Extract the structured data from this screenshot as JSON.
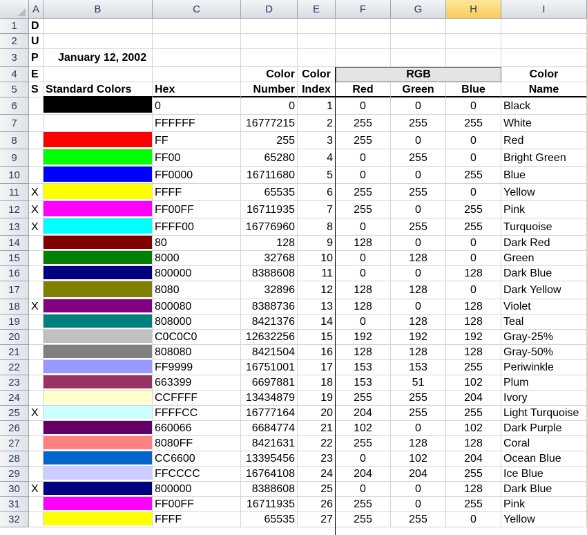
{
  "columns": [
    "A",
    "B",
    "C",
    "D",
    "E",
    "F",
    "G",
    "H",
    "I"
  ],
  "selected_column": "H",
  "row_numbers": [
    "1",
    "2",
    "3",
    "4",
    "5",
    "6",
    "7",
    "8",
    "9",
    "10",
    "11",
    "12",
    "13",
    "14",
    "15",
    "16",
    "17",
    "18",
    "19",
    "20",
    "21",
    "22",
    "23",
    "24",
    "25",
    "26",
    "27",
    "28",
    "29",
    "30",
    "31",
    "32"
  ],
  "col_a_letters": {
    "1": "D",
    "2": "U",
    "3": "P",
    "4": "E",
    "5": "S"
  },
  "date": "January 12, 2002",
  "headers": {
    "standard_colors": "Standard Colors",
    "hex": "Hex",
    "color_number_line1": "Color",
    "color_number_line2": "Number",
    "color_index_line1": "Color",
    "color_index_line2": "Index",
    "rgb": "RGB",
    "red": "Red",
    "green": "Green",
    "blue": "Blue",
    "color_name_line1": "Color",
    "color_name_line2": "Name"
  },
  "data_rows": [
    {
      "dup": "",
      "swatch": "#000000",
      "hex": "0",
      "number": "0",
      "index": "1",
      "red": "0",
      "green": "0",
      "blue": "0",
      "name": "Black"
    },
    {
      "dup": "",
      "swatch": "#FFFFFF",
      "hex": "FFFFFF",
      "number": "16777215",
      "index": "2",
      "red": "255",
      "green": "255",
      "blue": "255",
      "name": "White"
    },
    {
      "dup": "",
      "swatch": "#FF0000",
      "hex": "FF",
      "number": "255",
      "index": "3",
      "red": "255",
      "green": "0",
      "blue": "0",
      "name": "Red"
    },
    {
      "dup": "",
      "swatch": "#00FF00",
      "hex": "FF00",
      "number": "65280",
      "index": "4",
      "red": "0",
      "green": "255",
      "blue": "0",
      "name": "Bright Green"
    },
    {
      "dup": "",
      "swatch": "#0000FF",
      "hex": "FF0000",
      "number": "16711680",
      "index": "5",
      "red": "0",
      "green": "0",
      "blue": "255",
      "name": "Blue"
    },
    {
      "dup": "X",
      "swatch": "#FFFF00",
      "hex": "FFFF",
      "number": "65535",
      "index": "6",
      "red": "255",
      "green": "255",
      "blue": "0",
      "name": "Yellow"
    },
    {
      "dup": "X",
      "swatch": "#FF00FF",
      "hex": "FF00FF",
      "number": "16711935",
      "index": "7",
      "red": "255",
      "green": "0",
      "blue": "255",
      "name": "Pink"
    },
    {
      "dup": "X",
      "swatch": "#00FFFF",
      "hex": "FFFF00",
      "number": "16776960",
      "index": "8",
      "red": "0",
      "green": "255",
      "blue": "255",
      "name": "Turquoise"
    },
    {
      "dup": "",
      "swatch": "#800000",
      "hex": "80",
      "number": "128",
      "index": "9",
      "red": "128",
      "green": "0",
      "blue": "0",
      "name": "Dark Red"
    },
    {
      "dup": "",
      "swatch": "#008000",
      "hex": "8000",
      "number": "32768",
      "index": "10",
      "red": "0",
      "green": "128",
      "blue": "0",
      "name": "Green"
    },
    {
      "dup": "",
      "swatch": "#000080",
      "hex": "800000",
      "number": "8388608",
      "index": "11",
      "red": "0",
      "green": "0",
      "blue": "128",
      "name": "Dark Blue"
    },
    {
      "dup": "",
      "swatch": "#808000",
      "hex": "8080",
      "number": "32896",
      "index": "12",
      "red": "128",
      "green": "128",
      "blue": "0",
      "name": "Dark Yellow"
    },
    {
      "dup": "X",
      "swatch": "#800080",
      "hex": "800080",
      "number": "8388736",
      "index": "13",
      "red": "128",
      "green": "0",
      "blue": "128",
      "name": "Violet"
    },
    {
      "dup": "",
      "swatch": "#008080",
      "hex": "808000",
      "number": "8421376",
      "index": "14",
      "red": "0",
      "green": "128",
      "blue": "128",
      "name": "Teal"
    },
    {
      "dup": "",
      "swatch": "#C0C0C0",
      "hex": "C0C0C0",
      "number": "12632256",
      "index": "15",
      "red": "192",
      "green": "192",
      "blue": "192",
      "name": "Gray-25%"
    },
    {
      "dup": "",
      "swatch": "#808080",
      "hex": "808080",
      "number": "8421504",
      "index": "16",
      "red": "128",
      "green": "128",
      "blue": "128",
      "name": "Gray-50%"
    },
    {
      "dup": "",
      "swatch": "#9999FF",
      "hex": "FF9999",
      "number": "16751001",
      "index": "17",
      "red": "153",
      "green": "153",
      "blue": "255",
      "name": "Periwinkle"
    },
    {
      "dup": "",
      "swatch": "#993366",
      "hex": "663399",
      "number": "6697881",
      "index": "18",
      "red": "153",
      "green": "51",
      "blue": "102",
      "name": "Plum"
    },
    {
      "dup": "",
      "swatch": "#FFFFCC",
      "hex": "CCFFFF",
      "number": "13434879",
      "index": "19",
      "red": "255",
      "green": "255",
      "blue": "204",
      "name": "Ivory"
    },
    {
      "dup": "X",
      "swatch": "#CCFFFF",
      "hex": "FFFFCC",
      "number": "16777164",
      "index": "20",
      "red": "204",
      "green": "255",
      "blue": "255",
      "name": "Light Turquoise"
    },
    {
      "dup": "",
      "swatch": "#660066",
      "hex": "660066",
      "number": "6684774",
      "index": "21",
      "red": "102",
      "green": "0",
      "blue": "102",
      "name": "Dark Purple"
    },
    {
      "dup": "",
      "swatch": "#FF8080",
      "hex": "8080FF",
      "number": "8421631",
      "index": "22",
      "red": "255",
      "green": "128",
      "blue": "128",
      "name": "Coral"
    },
    {
      "dup": "",
      "swatch": "#0066CC",
      "hex": "CC6600",
      "number": "13395456",
      "index": "23",
      "red": "0",
      "green": "102",
      "blue": "204",
      "name": "Ocean Blue"
    },
    {
      "dup": "",
      "swatch": "#CCCCFF",
      "hex": "FFCCCC",
      "number": "16764108",
      "index": "24",
      "red": "204",
      "green": "204",
      "blue": "255",
      "name": "Ice Blue"
    },
    {
      "dup": "X",
      "swatch": "#000080",
      "hex": "800000",
      "number": "8388608",
      "index": "25",
      "red": "0",
      "green": "0",
      "blue": "128",
      "name": "Dark Blue"
    },
    {
      "dup": "",
      "swatch": "#FF00FF",
      "hex": "FF00FF",
      "number": "16711935",
      "index": "26",
      "red": "255",
      "green": "0",
      "blue": "255",
      "name": "Pink"
    },
    {
      "dup": "",
      "swatch": "#FFFF00",
      "hex": "FFFF",
      "number": "65535",
      "index": "27",
      "red": "255",
      "green": "255",
      "blue": "0",
      "name": "Yellow"
    }
  ]
}
